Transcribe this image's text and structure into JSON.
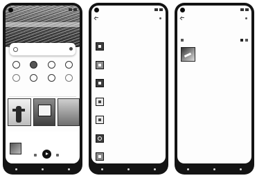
{
  "screens": {
    "home": {},
    "genres": {},
    "library": {}
  },
  "colors": {
    "phone_frame": "#141414",
    "screen_bg": "#fdfdfd",
    "accent": "#111111"
  },
  "icons": {
    "home": [
      "search-icon",
      "profile-icon",
      "category-icon",
      "play-icon",
      "nav-back-icon",
      "nav-home-icon",
      "nav-recent-icon"
    ],
    "genres": [
      "back-arrow-icon",
      "more-icon",
      "genre-icon"
    ],
    "library": [
      "back-arrow-icon",
      "sort-icon",
      "grid-icon",
      "more-icon"
    ]
  }
}
